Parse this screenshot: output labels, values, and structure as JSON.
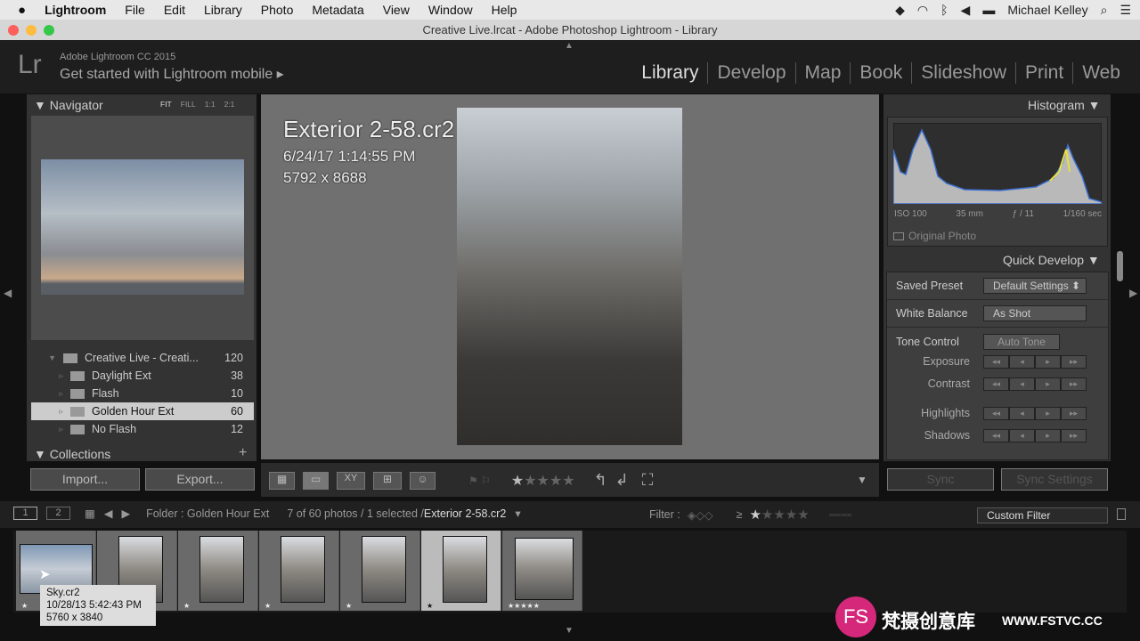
{
  "menubar": {
    "apple": "",
    "items": [
      "Lightroom",
      "File",
      "Edit",
      "Library",
      "Photo",
      "Metadata",
      "View",
      "Window",
      "Help"
    ],
    "user": "Michael Kelley"
  },
  "window": {
    "title": "Creative Live.lrcat - Adobe Photoshop Lightroom - Library"
  },
  "identity": {
    "logo": "Lr",
    "product": "Adobe Lightroom CC 2015",
    "mobile": "Get started with Lightroom mobile ▸"
  },
  "modules": [
    "Library",
    "Develop",
    "Map",
    "Book",
    "Slideshow",
    "Print",
    "Web"
  ],
  "navigator": {
    "title": "Navigator",
    "zoom": [
      "FIT",
      "FILL",
      "1:1",
      "2:1"
    ]
  },
  "folders": [
    {
      "name": "Creative Live - Creati...",
      "count": "120",
      "level": 0
    },
    {
      "name": "Daylight Ext",
      "count": "38",
      "level": 1
    },
    {
      "name": "Flash",
      "count": "10",
      "level": 1
    },
    {
      "name": "Golden Hour Ext",
      "count": "60",
      "level": 1,
      "selected": true
    },
    {
      "name": "No Flash",
      "count": "12",
      "level": 1
    }
  ],
  "collections": {
    "title": "Collections",
    "add": "+"
  },
  "left_buttons": {
    "import": "Import...",
    "export": "Export..."
  },
  "photo": {
    "name": "Exterior 2-58.cr2",
    "date": "6/24/17 1:14:55 PM",
    "dims": "5792 x 8688"
  },
  "histogram": {
    "title": "Histogram",
    "iso": "ISO 100",
    "focal": "35 mm",
    "aperture": "ƒ / 11",
    "shutter": "1/160 sec",
    "original": "Original Photo"
  },
  "quick_develop": {
    "title": "Quick Develop",
    "saved_preset_label": "Saved Preset",
    "saved_preset": "Default Settings",
    "wb_label": "White Balance",
    "wb": "As Shot",
    "tone_label": "Tone Control",
    "auto_tone": "Auto Tone",
    "sliders": [
      "Exposure",
      "Contrast",
      "Highlights",
      "Shadows"
    ]
  },
  "sync": {
    "sync": "Sync",
    "sync_settings": "Sync Settings"
  },
  "filmstrip": {
    "screen1": "1",
    "screen2": "2",
    "source": "Folder : Golden Hour Ext",
    "count": "7 of 60 photos / 1 selected /",
    "selected": "Exterior 2-58.cr2",
    "filter_label": "Filter :",
    "rating_op": "≥",
    "custom_filter": "Custom Filter",
    "thumbs": [
      {
        "stars": "★",
        "selected": false
      },
      {
        "stars": "",
        "selected": false
      },
      {
        "stars": "★",
        "selected": false
      },
      {
        "stars": "★",
        "selected": false
      },
      {
        "stars": "★",
        "selected": false
      },
      {
        "stars": "★",
        "selected": true
      },
      {
        "stars": "★★★★★",
        "selected": false
      }
    ]
  },
  "tooltip": {
    "name": "Sky.cr2",
    "date": "10/28/13 5:42:43 PM",
    "dims": "5760 x 3840"
  },
  "watermark": {
    "text": "梵摄创意库",
    "url": "WWW.FSTVC.CC",
    "logo": "FS"
  }
}
